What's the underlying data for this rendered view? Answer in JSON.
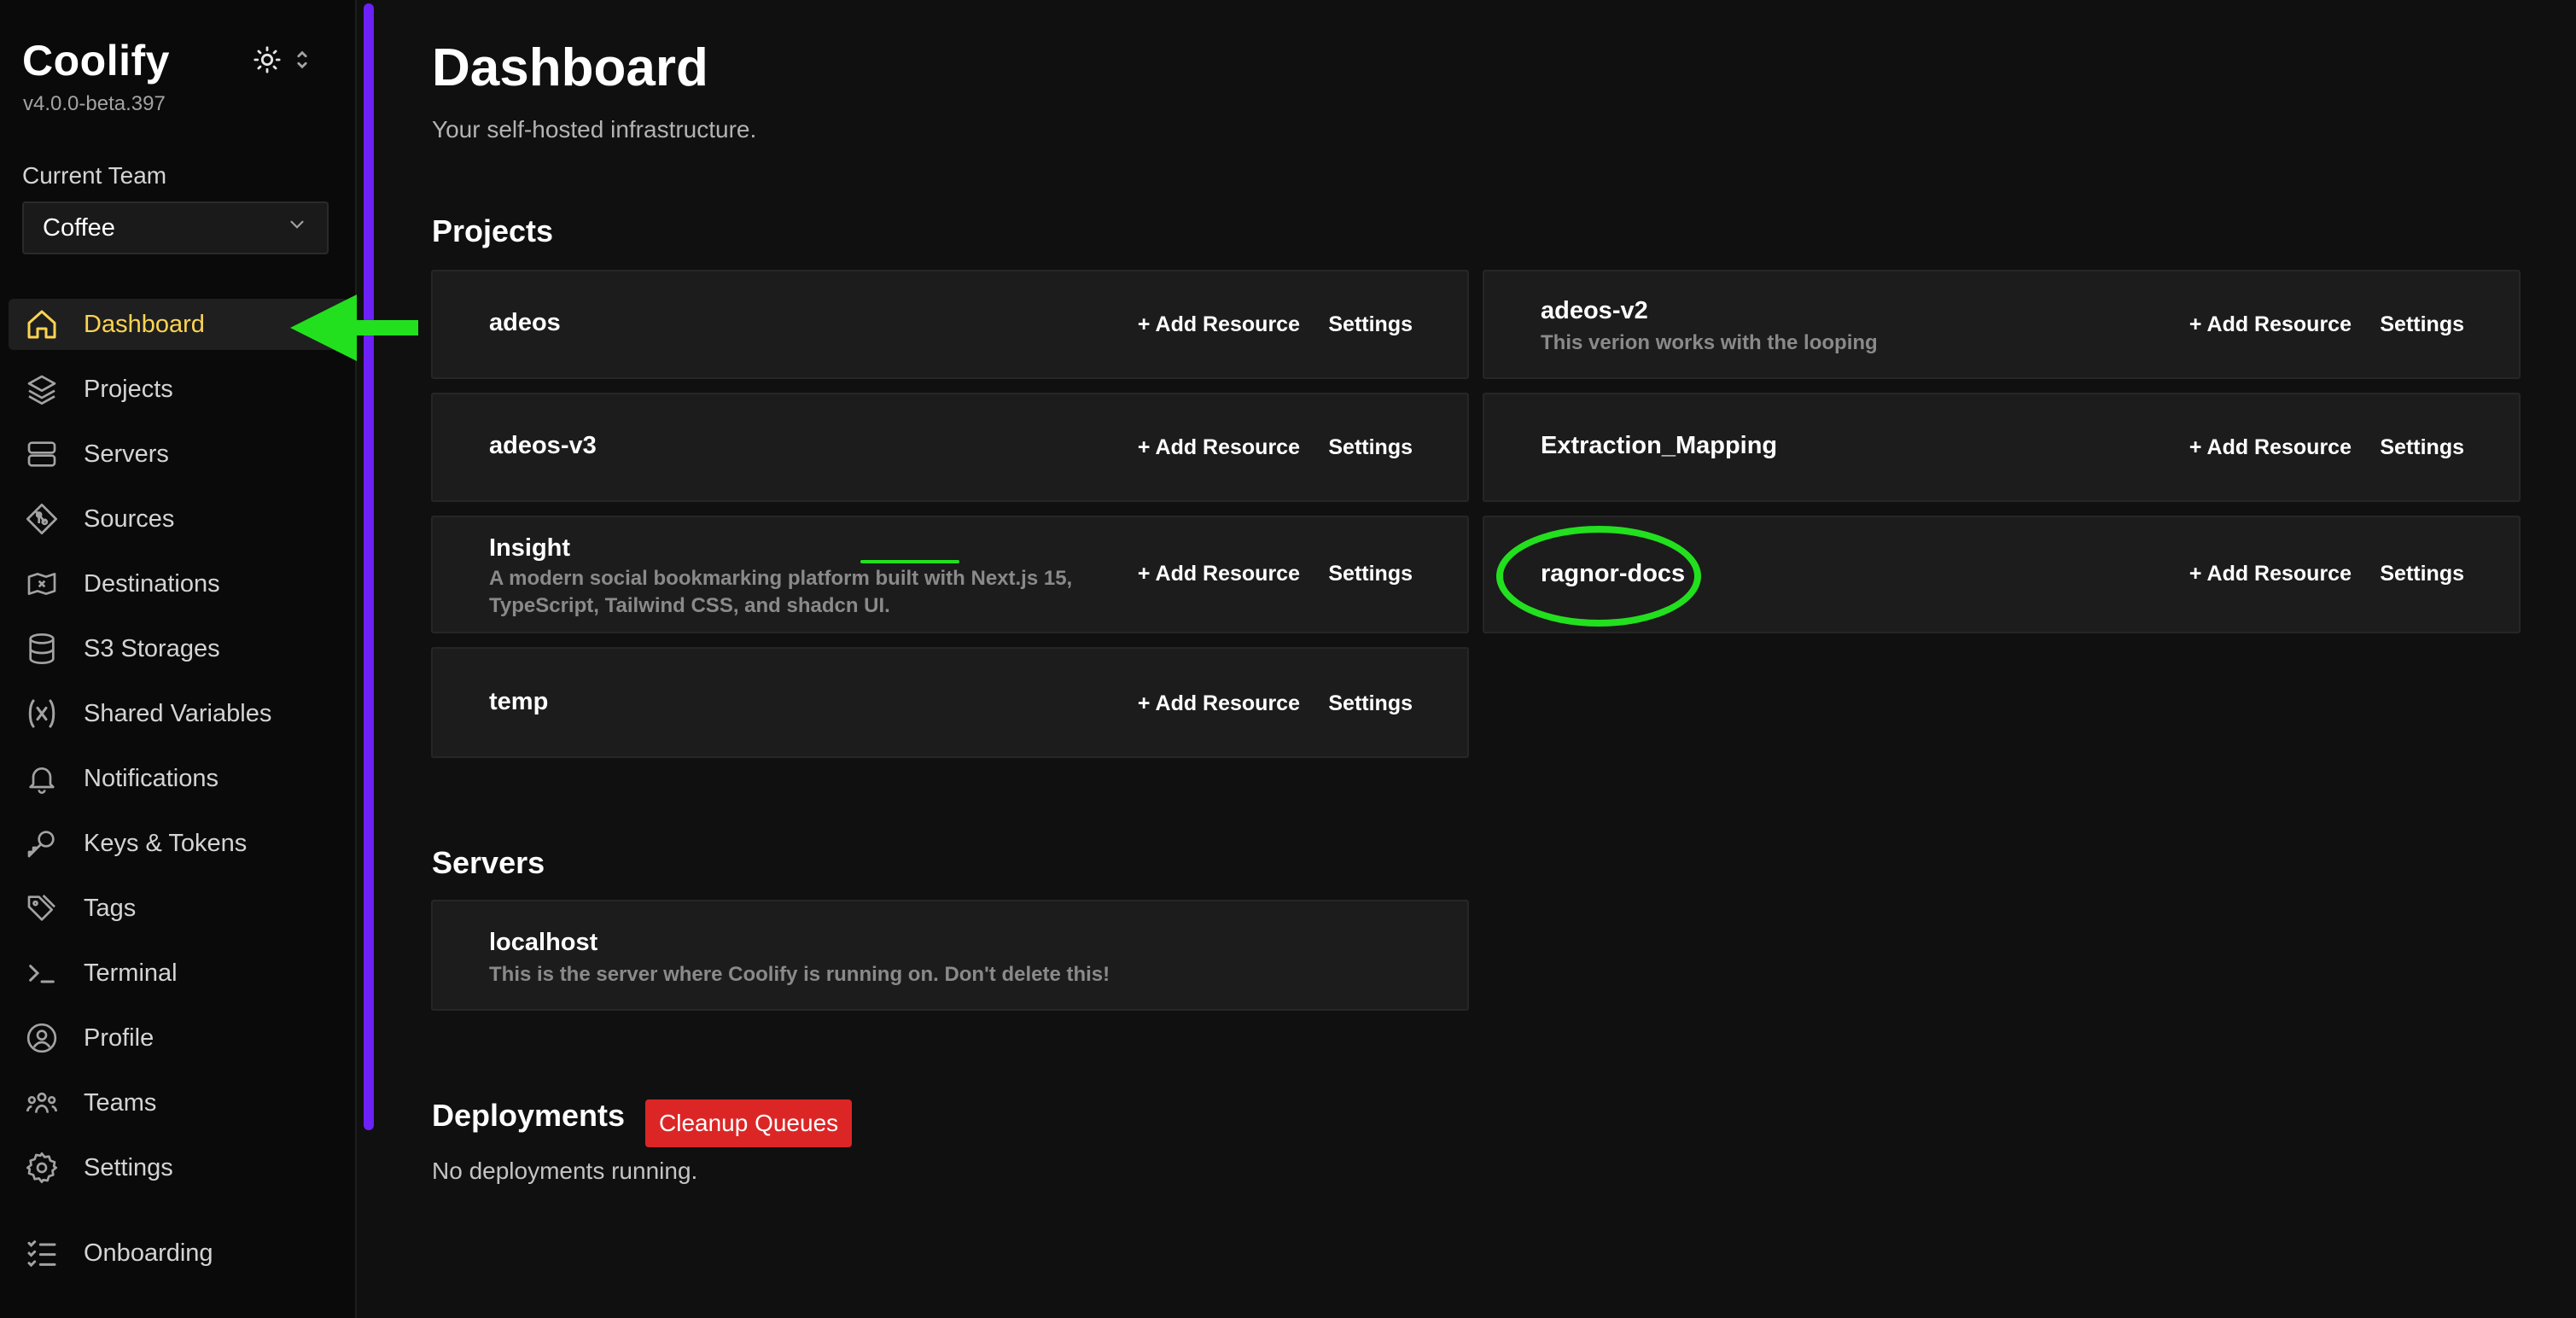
{
  "app": {
    "title": "Coolify",
    "version": "v4.0.0-beta.397"
  },
  "team": {
    "label": "Current Team",
    "selected": "Coffee"
  },
  "sidebar": {
    "items": [
      {
        "label": "Dashboard",
        "icon": "home-icon",
        "active": true
      },
      {
        "label": "Projects",
        "icon": "layers-icon"
      },
      {
        "label": "Servers",
        "icon": "server-icon"
      },
      {
        "label": "Sources",
        "icon": "git-icon"
      },
      {
        "label": "Destinations",
        "icon": "docker-icon"
      },
      {
        "label": "S3 Storages",
        "icon": "database-icon"
      },
      {
        "label": "Shared Variables",
        "icon": "variable-icon"
      },
      {
        "label": "Notifications",
        "icon": "bell-icon"
      },
      {
        "label": "Keys & Tokens",
        "icon": "key-icon"
      },
      {
        "label": "Tags",
        "icon": "tag-icon"
      },
      {
        "label": "Terminal",
        "icon": "terminal-icon"
      },
      {
        "label": "Profile",
        "icon": "user-icon"
      },
      {
        "label": "Teams",
        "icon": "users-icon"
      },
      {
        "label": "Settings",
        "icon": "gear-icon"
      }
    ],
    "onboarding": {
      "label": "Onboarding",
      "icon": "checklist-icon"
    }
  },
  "page": {
    "title": "Dashboard",
    "subtitle": "Your self-hosted infrastructure."
  },
  "projects": {
    "title": "Projects",
    "add_label": "+ Add Resource",
    "settings_label": "Settings",
    "items": [
      {
        "name": "adeos",
        "description": ""
      },
      {
        "name": "adeos-v2",
        "description": "This verion works with the looping"
      },
      {
        "name": "adeos-v3",
        "description": ""
      },
      {
        "name": "Extraction_Mapping",
        "description": ""
      },
      {
        "name": "Insight",
        "description_line1": "A modern social bookmarking platform built with Next.js 15,",
        "description_line2": "TypeScript, Tailwind CSS, and shadcn UI."
      },
      {
        "name": "ragnor-docs",
        "description": ""
      },
      {
        "name": "temp",
        "description": ""
      }
    ]
  },
  "servers": {
    "title": "Servers",
    "items": [
      {
        "name": "localhost",
        "description": "This is the server where Coolify is running on. Don't delete this!"
      }
    ]
  },
  "deployments": {
    "title": "Deployments",
    "cleanup_label": "Cleanup Queues",
    "empty_text": "No deployments running."
  },
  "colors": {
    "accent_active": "#fcd452",
    "scrollbar": "#6b21f8",
    "danger": "#dc2626",
    "annotation": "#22e01e"
  }
}
